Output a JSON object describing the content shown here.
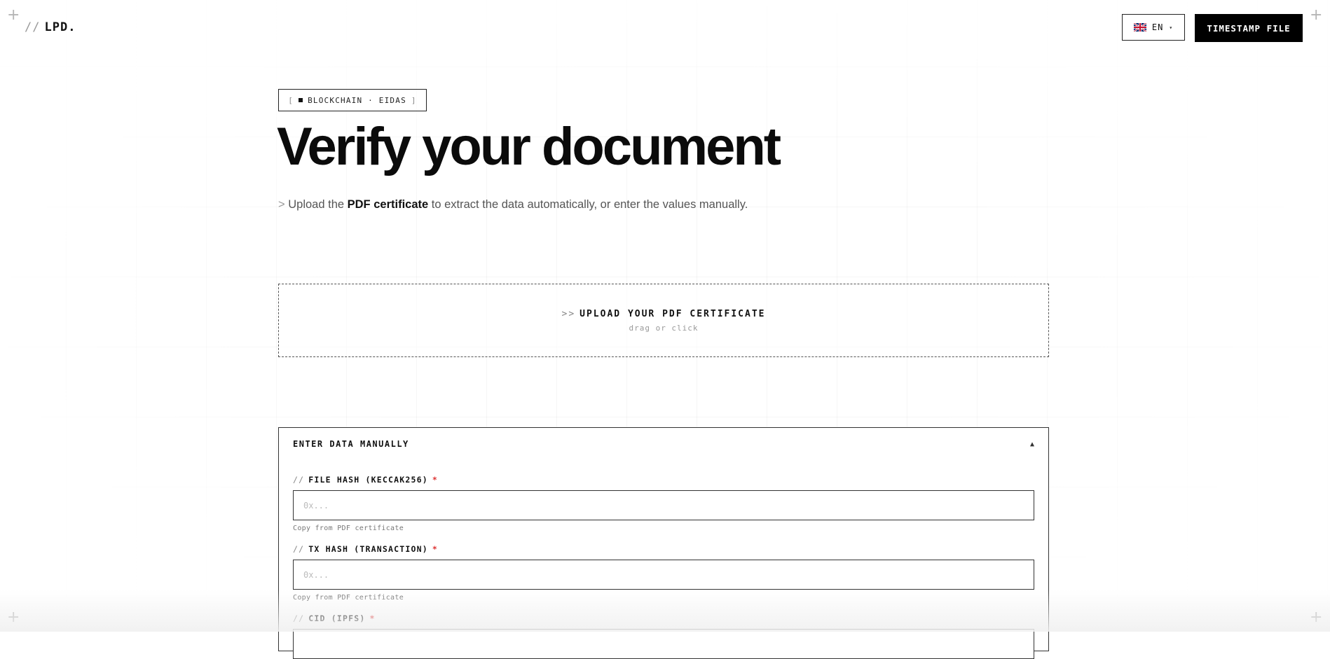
{
  "header": {
    "logo_slash": "//",
    "logo_text": "LPD.",
    "language": {
      "flag_icon": "uk-flag-icon",
      "code": "EN",
      "caret": "▾"
    },
    "cta_label": "TIMESTAMP FILE"
  },
  "hero": {
    "badge": {
      "open": "[",
      "text": "BLOCKCHAIN · EIDAS",
      "close": "]"
    },
    "title": "Verify your document",
    "subtitle": {
      "prefix": ">",
      "before": "Upload the",
      "bold": "PDF certificate",
      "after": "to extract the data automatically, or enter the values manually."
    }
  },
  "upload": {
    "arrows": ">>",
    "title": "UPLOAD YOUR PDF CERTIFICATE",
    "hint": "drag or click"
  },
  "manual": {
    "title": "ENTER DATA MANUALLY",
    "toggle_icon": "▲",
    "fields": [
      {
        "slash": "//",
        "label": "FILE HASH (KECCAK256)",
        "required": "*",
        "placeholder": "0x...",
        "value": "",
        "help": "Copy from PDF certificate"
      },
      {
        "slash": "//",
        "label": "TX HASH (TRANSACTION)",
        "required": "*",
        "placeholder": "0x...",
        "value": "",
        "help": "Copy from PDF certificate"
      },
      {
        "slash": "//",
        "label": "CID (IPFS)",
        "required": "*",
        "placeholder": "",
        "value": "",
        "help": ""
      }
    ]
  },
  "colors": {
    "accent": "#000000",
    "required": "#d33333",
    "background": "#ffffff"
  }
}
